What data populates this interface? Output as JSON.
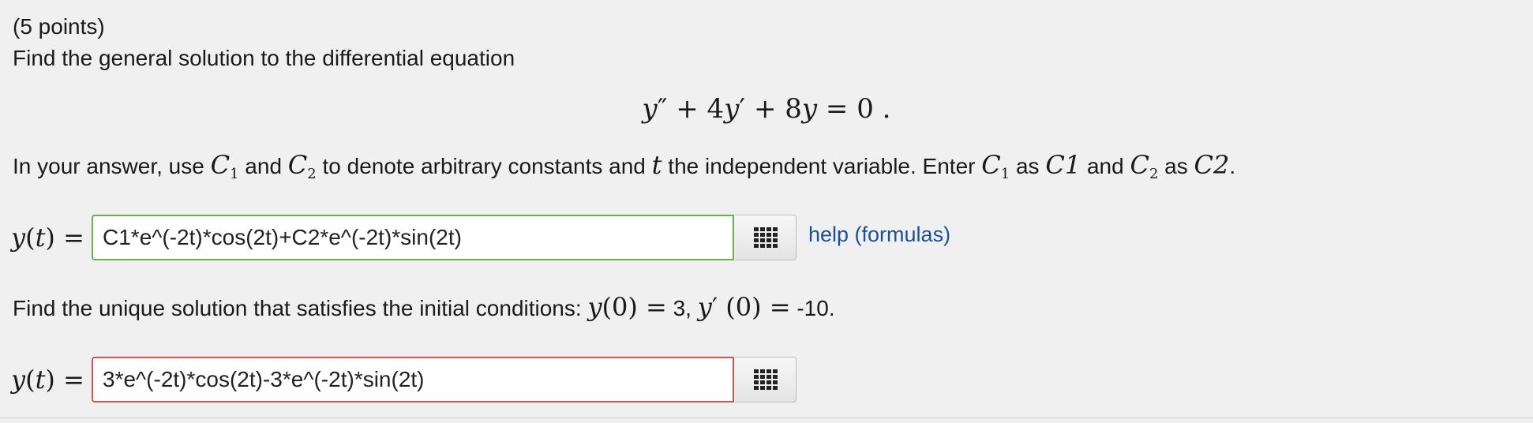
{
  "problem": {
    "points": "(5 points)",
    "prompt": "Find the general solution to the differential equation",
    "equation": {
      "y": "y",
      "dprime": "″",
      "plus1": " + ",
      "coef1": "4",
      "y1": "y",
      "prime": "′",
      "plus2": " + ",
      "coef2": "8",
      "y2": "y",
      "eq": " = 0 ."
    },
    "instructions": {
      "t1": "In your answer, use ",
      "c1_base": "C",
      "c1_sub": "1",
      "t2": " and ",
      "c2_base": "C",
      "c2_sub": "2",
      "t3": " to denote arbitrary constants and ",
      "t_var": "t",
      "t4": " the independent variable. Enter ",
      "c1b_base": "C",
      "c1b_sub": "1",
      "t5": " as ",
      "c1_code": "C1",
      "t6": " and ",
      "c2b_base": "C",
      "c2b_sub": "2",
      "t7": " as ",
      "c2_code": "C2",
      "t8": "."
    },
    "answer_label": {
      "y": "y",
      "open": "(",
      "t": "t",
      "close": ")",
      "eq": " ="
    },
    "general_answer": {
      "value": "C1*e^(-2t)*cos(2t)+C2*e^(-2t)*sin(2t)",
      "status": "correct"
    },
    "help_link": "help (formulas)",
    "unique_prompt": {
      "text": "Find the unique solution that satisfies the initial conditions: ",
      "y0_y": "y",
      "y0_arg": "(0) =",
      "y0_val": " 3, ",
      "yp_y": "y",
      "yp_prime": "′",
      "yp_arg": " (0) =",
      "yp_val": " -10."
    },
    "unique_answer": {
      "value": "3*e^(-2t)*cos(2t)-3*e^(-2t)*sin(2t)",
      "status": "incorrect"
    }
  },
  "colors": {
    "background": "#f0f0f0",
    "correct_border": "#6ab04c",
    "incorrect_border": "#d9534f",
    "link": "#1a4f9c"
  },
  "icons": {
    "palette": "grid-icon"
  }
}
